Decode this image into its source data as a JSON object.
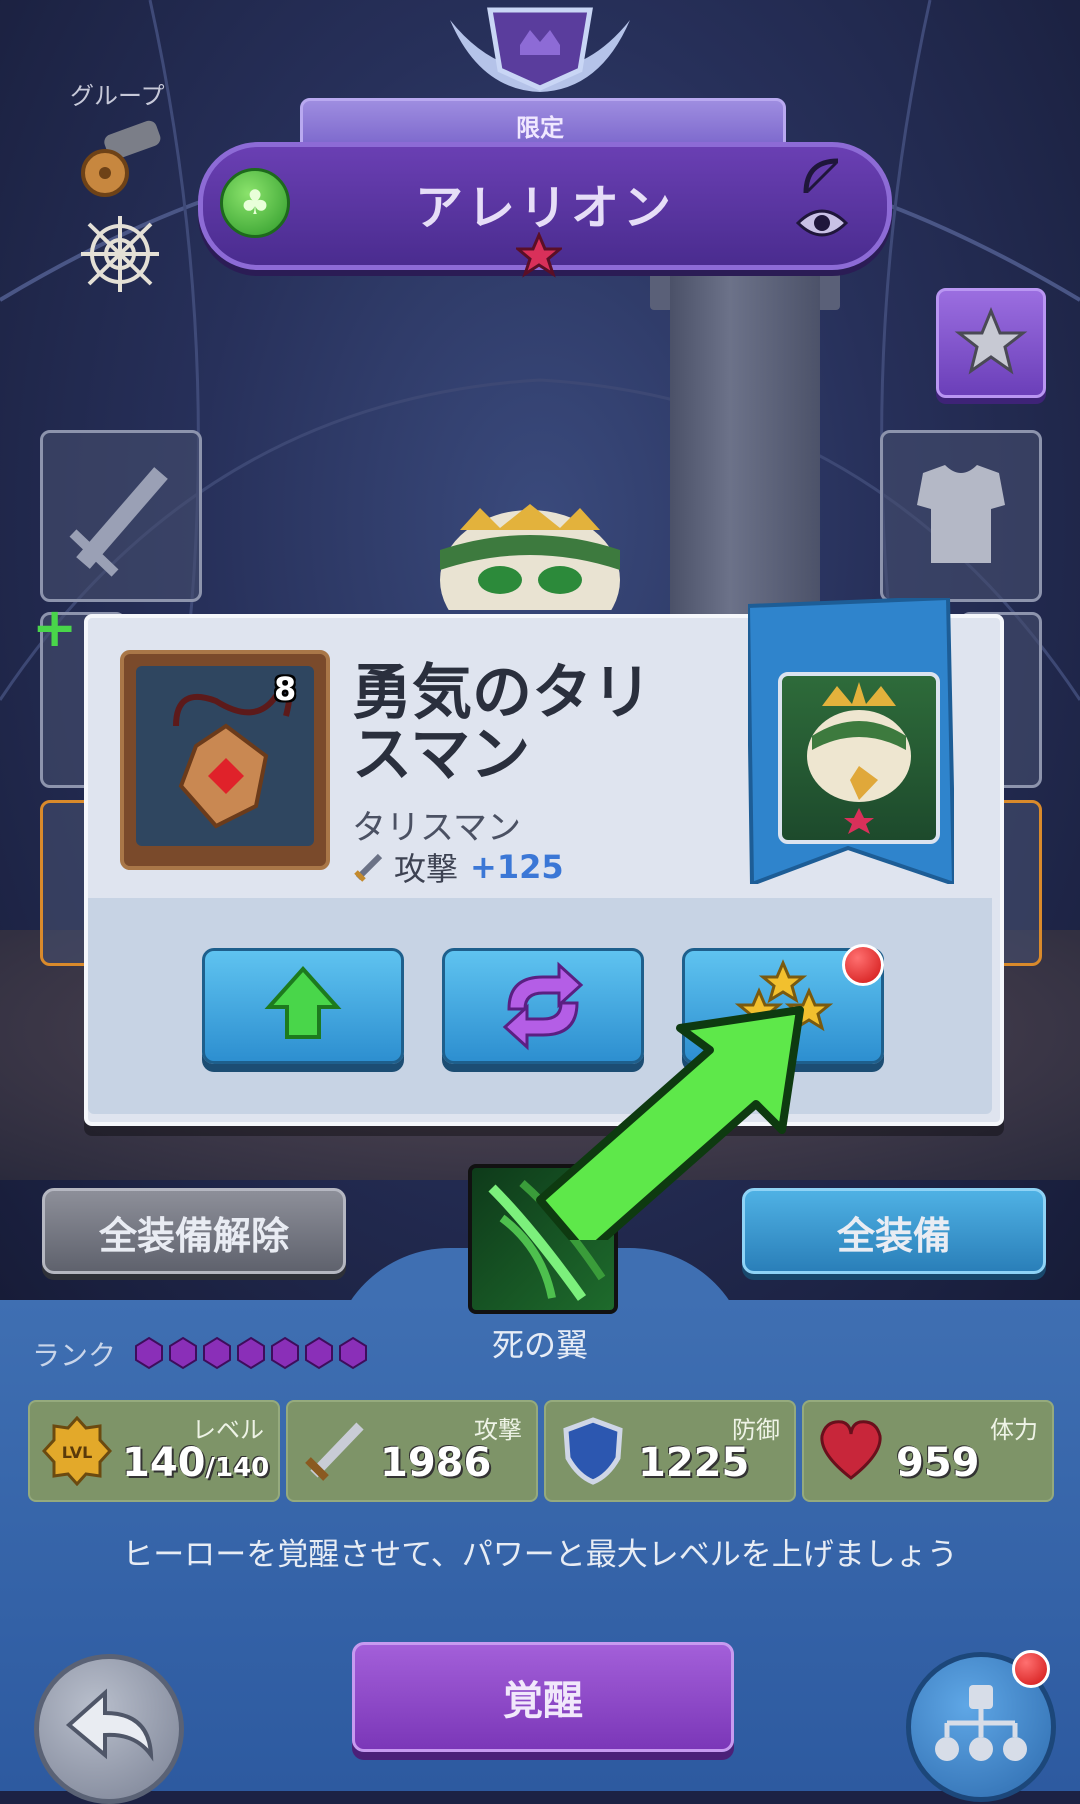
{
  "hero": {
    "tag": "限定",
    "name": "アレリオン"
  },
  "group": {
    "label": "グループ"
  },
  "item": {
    "count": "8",
    "name": "勇気のタリスマン",
    "type": "タリスマン",
    "stat_label": "攻撃",
    "stat_value": "+125"
  },
  "buttons": {
    "unequip_all": "全装備解除",
    "equip_all": "全装備",
    "awaken": "覚醒"
  },
  "skill": {
    "name": "死の翼"
  },
  "rank": {
    "label": "ランク",
    "gems": 7
  },
  "stats": [
    {
      "label": "レベル",
      "value": "140",
      "max": "/140",
      "icon": "level-icon"
    },
    {
      "label": "攻撃",
      "value": "1986",
      "icon": "sword-icon"
    },
    {
      "label": "防御",
      "value": "1225",
      "icon": "shield-icon"
    },
    {
      "label": "体力",
      "value": "959",
      "icon": "heart-icon"
    }
  ],
  "hint": "ヒーローを覚醒させて、パワーと最大レベルを上げましょう",
  "colors": {
    "accent_purple": "#6a3fb3",
    "button_blue": "#2d8fd0",
    "stat_green": "#7e9468",
    "notification_red": "#d01414"
  }
}
